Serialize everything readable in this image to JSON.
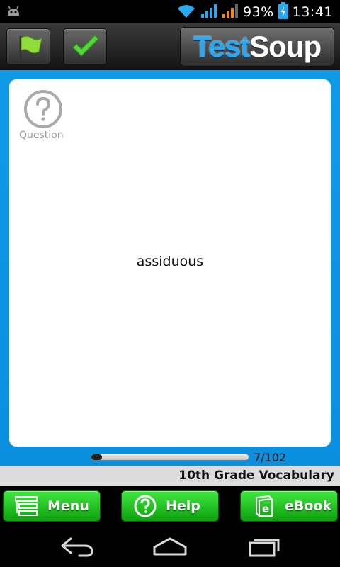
{
  "status_bar": {
    "battery_percent": "93%",
    "time": "13:41",
    "icons": [
      "android-debug-icon",
      "wifi-icon",
      "signal-icon",
      "signal-data-icon",
      "battery-charging-icon"
    ]
  },
  "toolbar": {
    "flag_icon": "flag-icon",
    "check_icon": "check-icon",
    "logo_part1": "Test",
    "logo_part2": "Soup"
  },
  "card": {
    "question_label": "Question",
    "question_icon": "question-circle-icon",
    "word": "assiduous"
  },
  "progress": {
    "text": "7/102",
    "current": 7,
    "total": 102
  },
  "deck": {
    "title": "10th Grade Vocabulary"
  },
  "bottom_buttons": {
    "menu_label": "Menu",
    "help_label": "Help",
    "ebook_label": "eBook"
  },
  "colors": {
    "accent_blue": "#0a93e3",
    "button_green": "#22c322",
    "logo_blue": "#2aa8f0"
  },
  "navigation": {
    "back_icon": "back-icon",
    "home_icon": "home-icon",
    "recent_icon": "recent-apps-icon"
  }
}
